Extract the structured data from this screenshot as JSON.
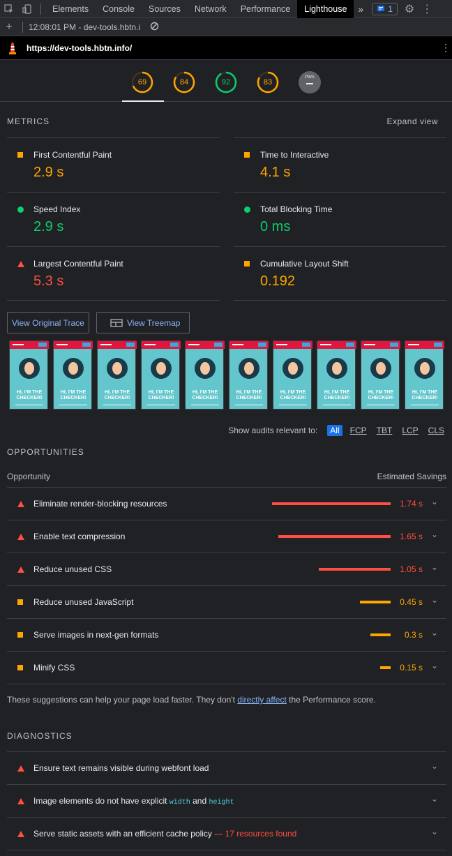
{
  "devtools": {
    "tabs": [
      "Elements",
      "Console",
      "Sources",
      "Network",
      "Performance",
      "Lighthouse"
    ],
    "issues_count": "1",
    "timestamp_report": "12:08:01 PM - dev-tools.hbtn.i"
  },
  "url": "https://dev-tools.hbtn.info/",
  "scores": [
    {
      "value": "69",
      "color": "#ffa400",
      "fraction": 0.69
    },
    {
      "value": "84",
      "color": "#ffa400",
      "fraction": 0.84
    },
    {
      "value": "92",
      "color": "#0cce6b",
      "fraction": 0.92
    },
    {
      "value": "83",
      "color": "#ffa400",
      "fraction": 0.83
    }
  ],
  "pwa_label": "PWA",
  "metrics": {
    "title": "METRICS",
    "expand_label": "Expand view",
    "items": [
      {
        "name": "First Contentful Paint",
        "value": "2.9 s",
        "status": "average",
        "color": "#ffa400"
      },
      {
        "name": "Time to Interactive",
        "value": "4.1 s",
        "status": "average",
        "color": "#ffa400"
      },
      {
        "name": "Speed Index",
        "value": "2.9 s",
        "status": "pass",
        "color": "#0cce6b"
      },
      {
        "name": "Total Blocking Time",
        "value": "0 ms",
        "status": "pass",
        "color": "#0cce6b"
      },
      {
        "name": "Largest Contentful Paint",
        "value": "5.3 s",
        "status": "fail",
        "color": "#ff4e42"
      },
      {
        "name": "Cumulative Layout Shift",
        "value": "0.192",
        "status": "average",
        "color": "#ffa400"
      }
    ]
  },
  "buttons": {
    "trace": "View Original Trace",
    "treemap": "View Treemap"
  },
  "filmstrip": {
    "frame_text": "HI, I'M THE CHECKER!",
    "count": 10
  },
  "filter": {
    "label": "Show audits relevant to:",
    "chips": [
      "All",
      "FCP",
      "TBT",
      "LCP",
      "CLS"
    ]
  },
  "opportunities": {
    "title": "OPPORTUNITIES",
    "col_left": "Opportunity",
    "col_right": "Estimated Savings",
    "items": [
      {
        "title": "Eliminate render-blocking resources",
        "savings": "1.74 s",
        "seconds": 1.74,
        "status": "fail",
        "color": "#ff4e42"
      },
      {
        "title": "Enable text compression",
        "savings": "1.65 s",
        "seconds": 1.65,
        "status": "fail",
        "color": "#ff4e42"
      },
      {
        "title": "Reduce unused CSS",
        "savings": "1.05 s",
        "seconds": 1.05,
        "status": "fail",
        "color": "#ff4e42"
      },
      {
        "title": "Reduce unused JavaScript",
        "savings": "0.45 s",
        "seconds": 0.45,
        "status": "average",
        "color": "#ffa400"
      },
      {
        "title": "Serve images in next-gen formats",
        "savings": "0.3 s",
        "seconds": 0.3,
        "status": "average",
        "color": "#ffa400"
      },
      {
        "title": "Minify CSS",
        "savings": "0.15 s",
        "seconds": 0.15,
        "status": "average",
        "color": "#ffa400"
      }
    ],
    "note_before": "These suggestions can help your page load faster. They don't ",
    "note_link": "directly affect",
    "note_after": " the Performance score."
  },
  "diagnostics": {
    "title": "DIAGNOSTICS",
    "item1": "Ensure text remains visible during webfont load",
    "item2_before": "Image elements do not have explicit ",
    "item2_code1": "width",
    "item2_mid": " and ",
    "item2_code2": "height",
    "item3": "Serve static assets with an efficient cache policy",
    "item3_detail": " — 17 resources found"
  }
}
